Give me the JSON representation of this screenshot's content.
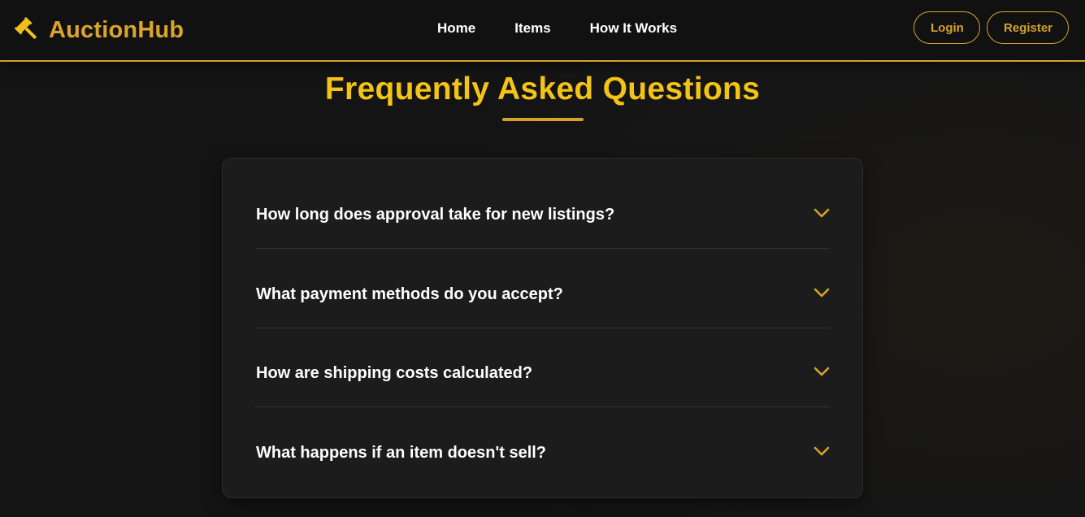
{
  "brand": {
    "name": "AuctionHub",
    "icon": "gavel-icon"
  },
  "nav": {
    "home": "Home",
    "items": "Items",
    "how_it_works": "How It Works"
  },
  "auth": {
    "login": "Login",
    "register": "Register"
  },
  "faq": {
    "title": "Frequently Asked Questions",
    "items": [
      {
        "question": "How long does approval take for new listings?"
      },
      {
        "question": "What payment methods do you accept?"
      },
      {
        "question": "How are shipping costs calculated?"
      },
      {
        "question": "What happens if an item doesn't sell?"
      }
    ]
  },
  "colors": {
    "accent": "#d4a22a",
    "title": "#f3c315",
    "background": "#151515",
    "card": "#1c1c1c",
    "text": "#ffffff"
  }
}
